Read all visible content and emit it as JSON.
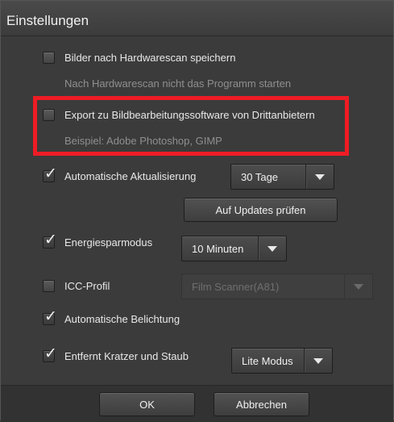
{
  "window": {
    "title": "Einstellungen"
  },
  "options": {
    "hardware_scan_save": {
      "label": "Bilder nach Hardwarescan speichern",
      "checked": false
    },
    "hardware_scan_hint": "Nach Hardwarescan nicht das Programm starten",
    "export_third_party": {
      "label": "Export zu Bildbearbeitungssoftware von Drittanbietern",
      "checked": false
    },
    "export_hint": "Beispiel: Adobe Photoshop, GIMP",
    "auto_update": {
      "label": "Automatische Aktualisierung",
      "checked": true,
      "interval": "30 Tage"
    },
    "check_updates_button": "Auf Updates prüfen",
    "energy_saving": {
      "label": "Energiesparmodus",
      "checked": true,
      "timeout": "10 Minuten"
    },
    "icc_profile": {
      "label": "ICC-Profil",
      "checked": false,
      "profile": "Film Scanner(A81)"
    },
    "auto_exposure": {
      "label": "Automatische Belichtung",
      "checked": true
    },
    "scratch_removal": {
      "label": "Entfernt Kratzer und Staub",
      "checked": true,
      "mode": "Lite Modus"
    }
  },
  "footer": {
    "ok_label": "OK",
    "cancel_label": "Abbrechen"
  },
  "colors": {
    "highlight": "#ee1c24",
    "background": "#3b3b3b"
  }
}
